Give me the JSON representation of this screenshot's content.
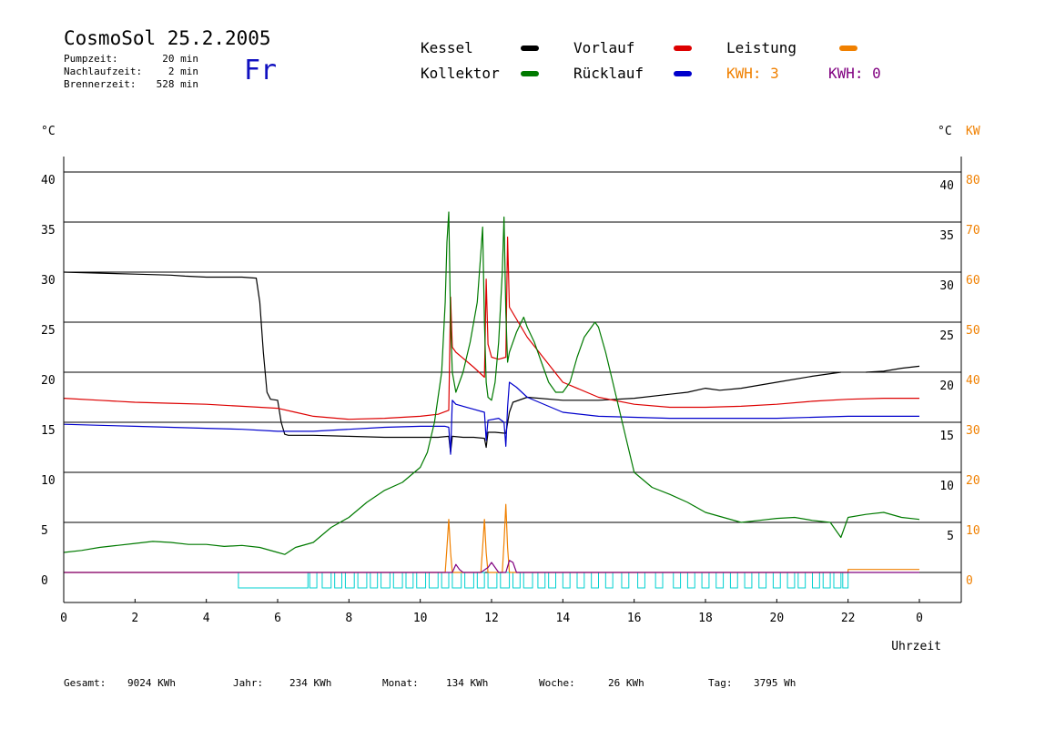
{
  "header": {
    "title": "CosmoSol 25.2.2005",
    "day": "Fr",
    "pumpzeit_label": "Pumpzeit:",
    "pumpzeit_value": "20 min",
    "nachlaufzeit_label": "Nachlaufzeit:",
    "nachlaufzeit_value": "2 min",
    "brennerzeit_label": "Brennerzeit:",
    "brennerzeit_value": "528 min"
  },
  "legend": {
    "kessel": "Kessel",
    "kollektor": "Kollektor",
    "vorlauf": "Vorlauf",
    "ruecklauf": "Rücklauf",
    "leistung": "Leistung",
    "kwh1": "KWH: 3",
    "kwh2": "KWH: 0"
  },
  "colors": {
    "kessel": "#000000",
    "kollektor": "#007a00",
    "vorlauf": "#dd0000",
    "ruecklauf": "#0000cc",
    "leistung": "#f08000",
    "kwh2": "#800080",
    "burner": "#00d0d0",
    "grid": "#000000"
  },
  "footer": {
    "gesamt_label": "Gesamt:",
    "gesamt_value": "9024 KWh",
    "jahr_label": "Jahr:",
    "jahr_value": "234 KWh",
    "monat_label": "Monat:",
    "monat_value": "134 KWh",
    "woche_label": "Woche:",
    "woche_value": "26 KWh",
    "tag_label": "Tag:",
    "tag_value": "3795 Wh"
  },
  "chart_data": {
    "type": "line",
    "xlabel": "Uhrzeit",
    "ylabel_left": "°C",
    "ylabel_right_c": "°C",
    "ylabel_right_kw": "KW",
    "xlim": [
      0,
      24
    ],
    "ylim": [
      0,
      40
    ],
    "ylim_right_kw": [
      0,
      80
    ],
    "x_ticks": [
      0,
      2,
      4,
      6,
      8,
      10,
      12,
      14,
      16,
      18,
      20,
      22,
      24
    ],
    "x_tick_labels": [
      "0",
      "2",
      "4",
      "6",
      "8",
      "10",
      "12",
      "14",
      "16",
      "18",
      "20",
      "22",
      "0"
    ],
    "y_ticks": [
      0,
      5,
      10,
      15,
      20,
      25,
      30,
      35,
      40
    ],
    "y_tick_labels": [
      "0",
      "5",
      "10",
      "15",
      "20",
      "25",
      "30",
      "35",
      "40"
    ],
    "y_right_kw_labels": [
      "0",
      "10",
      "20",
      "30",
      "40",
      "50",
      "60",
      "70",
      "80"
    ],
    "grid": true,
    "series": [
      {
        "name": "Kessel",
        "color_key": "kessel",
        "x": [
          0,
          1,
          2,
          3,
          3.4,
          4,
          5,
          5.4,
          5.5,
          5.6,
          5.7,
          5.8,
          6.0,
          6.1,
          6.2,
          6.3,
          7,
          8,
          9,
          10,
          10.5,
          10.8,
          10.85,
          10.9,
          11.2,
          11.5,
          11.8,
          11.85,
          11.9,
          12.1,
          12.4,
          12.5,
          12.6,
          13,
          14,
          15,
          16,
          17,
          17.5,
          18,
          18.4,
          19,
          20,
          21,
          21.8,
          22.0,
          22.5,
          23,
          23.5,
          24
        ],
        "y": [
          30.0,
          29.9,
          29.8,
          29.7,
          29.6,
          29.5,
          29.5,
          29.4,
          27,
          22,
          18,
          17.3,
          17.2,
          15,
          13.8,
          13.7,
          13.7,
          13.6,
          13.5,
          13.5,
          13.5,
          13.6,
          12.0,
          13.6,
          13.5,
          13.5,
          13.4,
          12.5,
          14,
          14,
          13.9,
          16,
          17,
          17.5,
          17.2,
          17.2,
          17.4,
          17.8,
          18.0,
          18.4,
          18.2,
          18.4,
          19.0,
          19.6,
          20.0,
          null,
          20.0,
          20.1,
          20.4,
          20.6
        ]
      },
      {
        "name": "Vorlauf",
        "color_key": "vorlauf",
        "x": [
          0,
          1,
          2,
          3,
          4,
          5,
          6,
          6.5,
          7,
          8,
          9,
          10,
          10.5,
          10.8,
          10.85,
          10.9,
          11,
          11.5,
          11.8,
          11.85,
          11.9,
          12.0,
          12.2,
          12.4,
          12.45,
          12.5,
          13,
          14,
          15,
          16,
          17,
          18,
          19,
          20,
          21,
          22,
          23,
          24
        ],
        "y": [
          17.4,
          17.2,
          17.0,
          16.9,
          16.8,
          16.6,
          16.4,
          16.0,
          15.6,
          15.3,
          15.4,
          15.6,
          15.8,
          16.2,
          27.5,
          22.5,
          22.0,
          20.5,
          19.5,
          29.3,
          22.8,
          21.5,
          21.3,
          21.5,
          33.5,
          26.5,
          23.5,
          19.0,
          17.5,
          16.8,
          16.5,
          16.5,
          16.6,
          16.8,
          17.1,
          17.3,
          17.4,
          17.4
        ]
      },
      {
        "name": "Rücklauf",
        "color_key": "ruecklauf",
        "x": [
          0,
          1,
          2,
          3,
          4,
          5,
          6,
          7,
          8,
          9,
          10,
          10.7,
          10.8,
          10.85,
          10.9,
          11,
          11.5,
          11.8,
          11.85,
          11.9,
          12.2,
          12.35,
          12.4,
          12.45,
          12.5,
          12.7,
          13,
          14,
          15,
          16,
          17,
          18,
          19,
          20,
          21,
          22,
          23,
          24
        ],
        "y": [
          14.8,
          14.7,
          14.6,
          14.5,
          14.4,
          14.3,
          14.1,
          14.1,
          14.3,
          14.5,
          14.6,
          14.6,
          14.5,
          11.8,
          17.2,
          16.8,
          16.3,
          16.0,
          13.2,
          15.2,
          15.4,
          15.0,
          12.6,
          16.5,
          19.0,
          18.5,
          17.5,
          16.0,
          15.6,
          15.5,
          15.4,
          15.4,
          15.4,
          15.4,
          15.5,
          15.6,
          15.6,
          15.6
        ]
      },
      {
        "name": "Kollektor",
        "color_key": "kollektor",
        "x": [
          0,
          0.5,
          1,
          1.5,
          2,
          2.5,
          3,
          3.5,
          4,
          4.5,
          5,
          5.5,
          6,
          6.2,
          6.5,
          7,
          7.5,
          8,
          8.5,
          9,
          9.5,
          10,
          10.2,
          10.4,
          10.6,
          10.7,
          10.75,
          10.8,
          10.85,
          10.9,
          11,
          11.2,
          11.4,
          11.6,
          11.7,
          11.75,
          11.8,
          11.85,
          11.9,
          12,
          12.1,
          12.2,
          12.3,
          12.35,
          12.4,
          12.45,
          12.5,
          12.7,
          12.9,
          13,
          13.2,
          13.4,
          13.6,
          13.8,
          14,
          14.2,
          14.4,
          14.6,
          14.8,
          14.9,
          15,
          15.2,
          15.4,
          15.6,
          15.8,
          16,
          16.5,
          17,
          17.5,
          18,
          18.5,
          19,
          19.5,
          20,
          20.5,
          21,
          21.5,
          21.8,
          22,
          22.5,
          23,
          23.5,
          24
        ],
        "y": [
          2.0,
          2.2,
          2.5,
          2.7,
          2.9,
          3.1,
          3.0,
          2.8,
          2.8,
          2.6,
          2.7,
          2.5,
          2.0,
          1.8,
          2.5,
          3.0,
          4.5,
          5.5,
          7.0,
          8.2,
          9.0,
          10.5,
          12.0,
          15.0,
          20.0,
          27.0,
          33.0,
          36.0,
          25.0,
          20.0,
          18.0,
          20.0,
          23.0,
          27.0,
          32.0,
          34.5,
          25.0,
          19.0,
          17.5,
          17.2,
          19.0,
          23.0,
          30.0,
          35.5,
          26.0,
          21.0,
          22.0,
          24.0,
          25.5,
          24.5,
          23.0,
          21.0,
          19.0,
          18.0,
          18.0,
          19.0,
          21.5,
          23.5,
          24.5,
          25.0,
          24.5,
          22.0,
          19.0,
          16.0,
          13.0,
          10.0,
          8.5,
          7.8,
          7.0,
          6.0,
          5.5,
          5.0,
          5.2,
          5.4,
          5.5,
          5.2,
          5.0,
          3.5,
          5.5,
          5.8,
          6.0,
          5.5,
          5.3
        ]
      },
      {
        "name": "Leistung",
        "color_key": "leistung",
        "x": [
          0,
          10.7,
          10.75,
          10.8,
          10.85,
          10.9,
          11.7,
          11.75,
          11.8,
          11.85,
          11.9,
          12.3,
          12.35,
          12.4,
          12.45,
          12.5,
          22.0,
          22.0,
          24
        ],
        "y": [
          0,
          0,
          2.5,
          5.3,
          2.0,
          0,
          0,
          2.5,
          5.3,
          2.0,
          0,
          0,
          3.0,
          6.8,
          2.5,
          0,
          0,
          0.3,
          0.3
        ]
      },
      {
        "name": "KWH2",
        "color_key": "kwh2",
        "x": [
          0,
          10.9,
          11.0,
          11.1,
          11.2,
          11.7,
          11.9,
          12.0,
          12.1,
          12.2,
          12.4,
          12.5,
          12.6,
          12.7,
          24
        ],
        "y": [
          0,
          0,
          0.8,
          0.3,
          0,
          0,
          0.5,
          1.0,
          0.5,
          0,
          0,
          1.2,
          1.0,
          0,
          0
        ]
      }
    ],
    "burner_periods": [
      [
        4.9,
        6.85
      ],
      [
        6.9,
        7.1
      ],
      [
        7.25,
        7.5
      ],
      [
        7.6,
        7.8
      ],
      [
        7.9,
        8.15
      ],
      [
        8.25,
        8.5
      ],
      [
        8.6,
        8.8
      ],
      [
        8.9,
        9.15
      ],
      [
        9.25,
        9.5
      ],
      [
        9.6,
        9.8
      ],
      [
        9.9,
        10.15
      ],
      [
        10.25,
        10.5
      ],
      [
        10.6,
        10.8
      ],
      [
        10.9,
        11.15
      ],
      [
        11.25,
        11.5
      ],
      [
        11.6,
        11.8
      ],
      [
        11.9,
        12.15
      ],
      [
        12.25,
        12.5
      ],
      [
        12.6,
        12.8
      ],
      [
        12.9,
        13.15
      ],
      [
        13.3,
        13.5
      ],
      [
        13.6,
        13.8
      ],
      [
        14.0,
        14.2
      ],
      [
        14.4,
        14.6
      ],
      [
        14.8,
        15.0
      ],
      [
        15.2,
        15.4
      ],
      [
        15.65,
        15.85
      ],
      [
        16.1,
        16.3
      ],
      [
        16.6,
        16.8
      ],
      [
        17.1,
        17.3
      ],
      [
        17.5,
        17.7
      ],
      [
        17.9,
        18.1
      ],
      [
        18.3,
        18.5
      ],
      [
        18.7,
        18.9
      ],
      [
        19.1,
        19.3
      ],
      [
        19.5,
        19.7
      ],
      [
        19.9,
        20.1
      ],
      [
        20.3,
        20.5
      ],
      [
        20.6,
        20.8
      ],
      [
        21.0,
        21.2
      ],
      [
        21.3,
        21.5
      ],
      [
        21.6,
        21.8
      ],
      [
        21.85,
        22.0
      ]
    ]
  }
}
